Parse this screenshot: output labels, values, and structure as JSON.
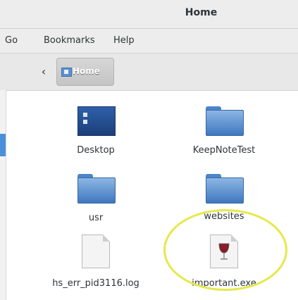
{
  "window": {
    "title": "Home"
  },
  "menubar": {
    "items": [
      "Go",
      "Bookmarks",
      "Help"
    ]
  },
  "toolbar": {
    "back_glyph": "‹",
    "path_label": "Home",
    "path_icon": "home-folder-icon"
  },
  "files": [
    {
      "name": "Desktop",
      "icon": "desktop-folder-icon"
    },
    {
      "name": "KeepNoteTest",
      "icon": "folder-icon"
    },
    {
      "name": "usr",
      "icon": "folder-icon"
    },
    {
      "name": "websites",
      "icon": "folder-icon"
    },
    {
      "name": "hs_err_pid3116.log",
      "icon": "text-file-icon"
    },
    {
      "name": "important.exe",
      "icon": "wine-exe-icon"
    }
  ],
  "colors": {
    "accent": "#4a90d9",
    "folder": "#4b86c8",
    "highlight_circle": "#e6e84a"
  }
}
